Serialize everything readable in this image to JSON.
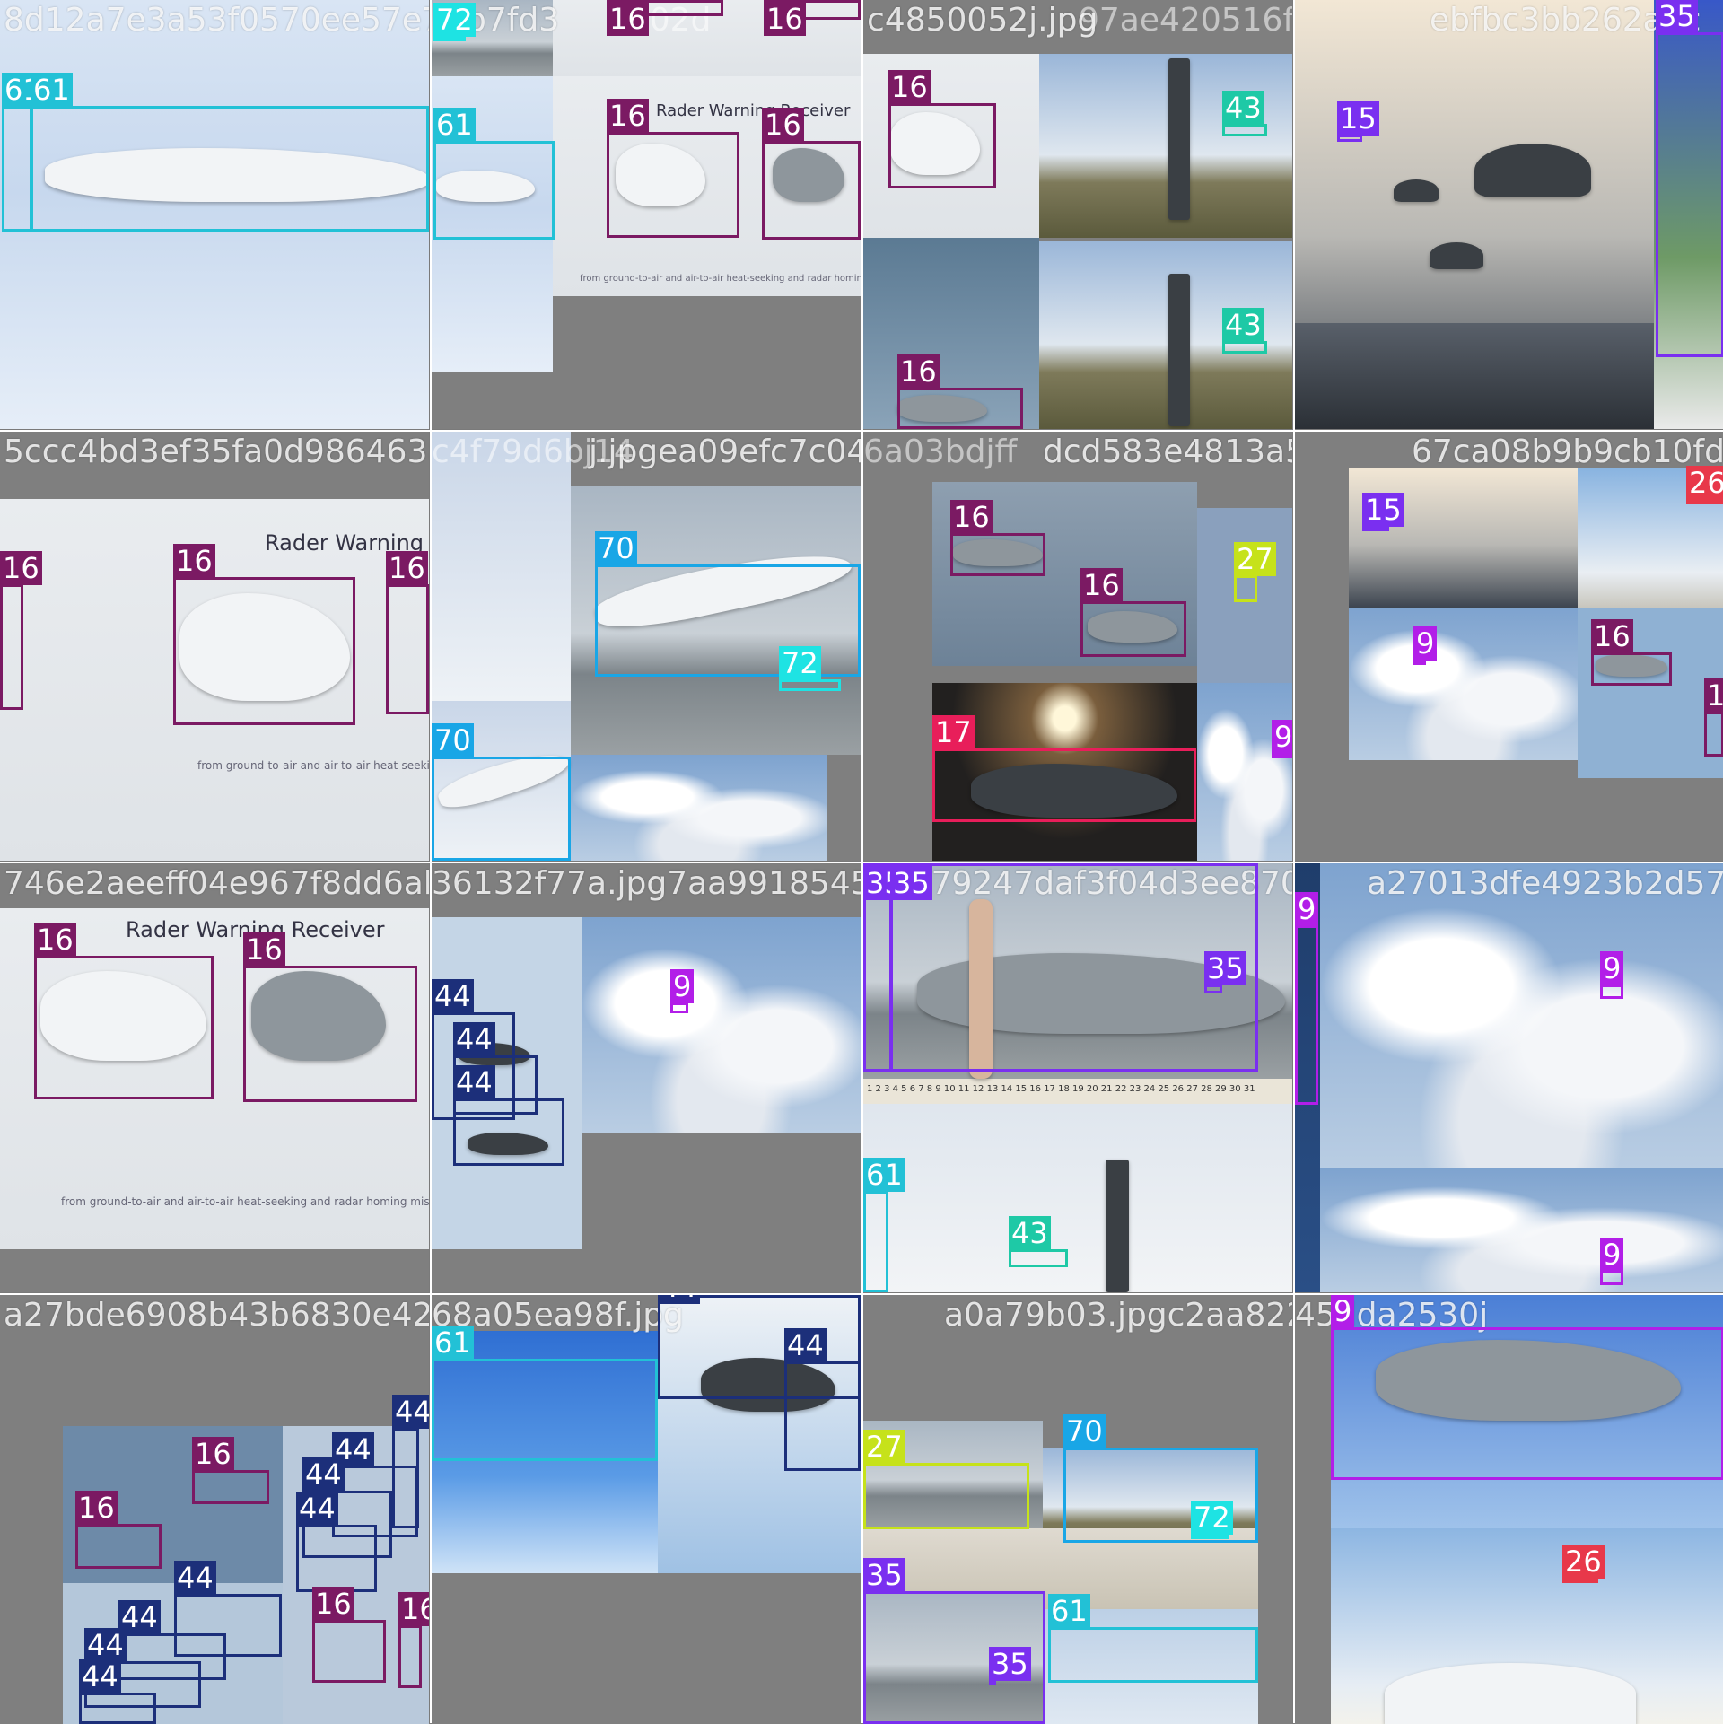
{
  "grid": [
    {
      "title": "8d12a7e3a53f0570ee57e75",
      "boxes": [
        {
          "label": "61",
          "color": "#22c1d6"
        },
        {
          "label": "61",
          "color": "#22c1d6"
        }
      ]
    },
    {
      "title": "b7fd3",
      "title_ghost": "c802d",
      "boxes": [
        {
          "label": "72",
          "color": "#1ee3e3"
        },
        {
          "label": "16",
          "color": "#7b1a63"
        },
        {
          "label": "16",
          "color": "#7b1a63"
        },
        {
          "label": "61",
          "color": "#22c1d6"
        },
        {
          "label": "16",
          "color": "#7b1a63"
        },
        {
          "label": "16",
          "color": "#7b1a63"
        }
      ],
      "text_rwr": "Rader Warning Receiver",
      "text_caption": "from ground-to-air and air-to-air heat-seeking and radar homing missiles."
    },
    {
      "title": "c4850052j.jpg",
      "title_ghost": "97ae420516f98",
      "boxes": [
        {
          "label": "16",
          "color": "#7b1a63"
        },
        {
          "label": "43",
          "color": "#1ec9a6"
        },
        {
          "label": "43",
          "color": "#1ec9a6"
        },
        {
          "label": "16",
          "color": "#7b1a63"
        }
      ]
    },
    {
      "title": "ebfbc3bb262a3c",
      "boxes": [
        {
          "label": "35",
          "color": "#7a2ff0"
        },
        {
          "label": "15",
          "color": "#7a2ff0"
        }
      ]
    },
    {
      "title": "5ccc4bd3ef35fa0d98646383",
      "boxes": [
        {
          "label": "16",
          "color": "#7b1a63"
        },
        {
          "label": "16",
          "color": "#7b1a63"
        },
        {
          "label": "16",
          "color": "#7b1a63"
        }
      ],
      "text_rwr": "Rader Warning Rec",
      "text_caption": "from ground-to-air and air-to-air heat-seeking an"
    },
    {
      "title": "j.jpgea09efc7c0411590615",
      "title_ghost": "c4f79d6bj14",
      "boxes": [
        {
          "label": "70",
          "color": "#19a6e6"
        },
        {
          "label": "72",
          "color": "#1ee3e3"
        },
        {
          "label": "70",
          "color": "#19a6e6"
        }
      ]
    },
    {
      "title": "dcd583e4813a528c2",
      "title_ghost": "6a03bdjff",
      "boxes": [
        {
          "label": "16",
          "color": "#7b1a63"
        },
        {
          "label": "16",
          "color": "#7b1a63"
        },
        {
          "label": "27",
          "color": "#c6e21a"
        },
        {
          "label": "17",
          "color": "#e81e5a"
        },
        {
          "label": "9",
          "color": "#b21ee8"
        }
      ]
    },
    {
      "title": "67ca08b9b9cb10fd851866",
      "boxes": [
        {
          "label": "15",
          "color": "#7a2ff0"
        },
        {
          "label": "26",
          "color": "#e8384a"
        },
        {
          "label": "9",
          "color": "#b21ee8"
        },
        {
          "label": "16",
          "color": "#7b1a63"
        },
        {
          "label": "16",
          "color": "#7b1a63"
        }
      ]
    },
    {
      "title": "746e2aeeff04e967f8dd6abb",
      "boxes": [
        {
          "label": "16",
          "color": "#7b1a63"
        },
        {
          "label": "16",
          "color": "#7b1a63"
        }
      ],
      "text_rwr": "Rader Warning Receiver",
      "text_caption": "from ground-to-air and air-to-air heat-seeking and radar homing missiles."
    },
    {
      "title": "36132f77a.jpg7aa991854560c",
      "boxes": [
        {
          "label": "9",
          "color": "#b21ee8"
        },
        {
          "label": "44",
          "color": "#1c2f7a"
        },
        {
          "label": "44",
          "color": "#1c2f7a"
        },
        {
          "label": "44",
          "color": "#1c2f7a"
        }
      ]
    },
    {
      "title": "f479247daf3f04d3ee870a58",
      "boxes": [
        {
          "label": "35",
          "color": "#7a2ff0"
        },
        {
          "label": "35",
          "color": "#7a2ff0"
        },
        {
          "label": "35",
          "color": "#7a2ff0"
        },
        {
          "label": "61",
          "color": "#22c1d6"
        },
        {
          "label": "43",
          "color": "#1ec9a6"
        }
      ],
      "calendar": "1 2 3 4 5 6 7 8 9 10 11 12 13 14 15 16 17 18 19 20 21 22 23 24 25 26 27 28 29 30 31"
    },
    {
      "title": "a27013dfe4923b2d577425",
      "boxes": [
        {
          "label": "9",
          "color": "#b21ee8"
        },
        {
          "label": "9",
          "color": "#b21ee8"
        },
        {
          "label": "9",
          "color": "#b21ee8"
        }
      ]
    },
    {
      "title": "a27bde6908b43b6830e424",
      "boxes": [
        {
          "label": "16",
          "color": "#7b1a63"
        },
        {
          "label": "16",
          "color": "#7b1a63"
        },
        {
          "label": "44",
          "color": "#1c2f7a"
        },
        {
          "label": "44",
          "color": "#1c2f7a"
        },
        {
          "label": "44",
          "color": "#1c2f7a"
        },
        {
          "label": "44",
          "color": "#1c2f7a"
        },
        {
          "label": "44",
          "color": "#1c2f7a"
        },
        {
          "label": "44",
          "color": "#1c2f7a"
        },
        {
          "label": "44",
          "color": "#1c2f7a"
        },
        {
          "label": "44",
          "color": "#1c2f7a"
        },
        {
          "label": "16",
          "color": "#7b1a63"
        },
        {
          "label": "16",
          "color": "#7b1a63"
        }
      ]
    },
    {
      "title": "68a05ea98f.jpg",
      "boxes": [
        {
          "label": "61",
          "color": "#22c1d6"
        },
        {
          "label": "44",
          "color": "#1c2f7a"
        },
        {
          "label": "44",
          "color": "#1c2f7a"
        }
      ]
    },
    {
      "title": "a0a79b03.jpgc2aa8222e234",
      "boxes": [
        {
          "label": "27",
          "color": "#c6e21a"
        },
        {
          "label": "70",
          "color": "#19a6e6"
        },
        {
          "label": "72",
          "color": "#1ee3e3"
        },
        {
          "label": "35",
          "color": "#7a2ff0"
        },
        {
          "label": "35",
          "color": "#7a2ff0"
        },
        {
          "label": "61",
          "color": "#22c1d6"
        }
      ]
    },
    {
      "title": "45dda2530j",
      "boxes": [
        {
          "label": "9",
          "color": "#b21ee8"
        },
        {
          "label": "26",
          "color": "#e8384a"
        }
      ]
    }
  ]
}
